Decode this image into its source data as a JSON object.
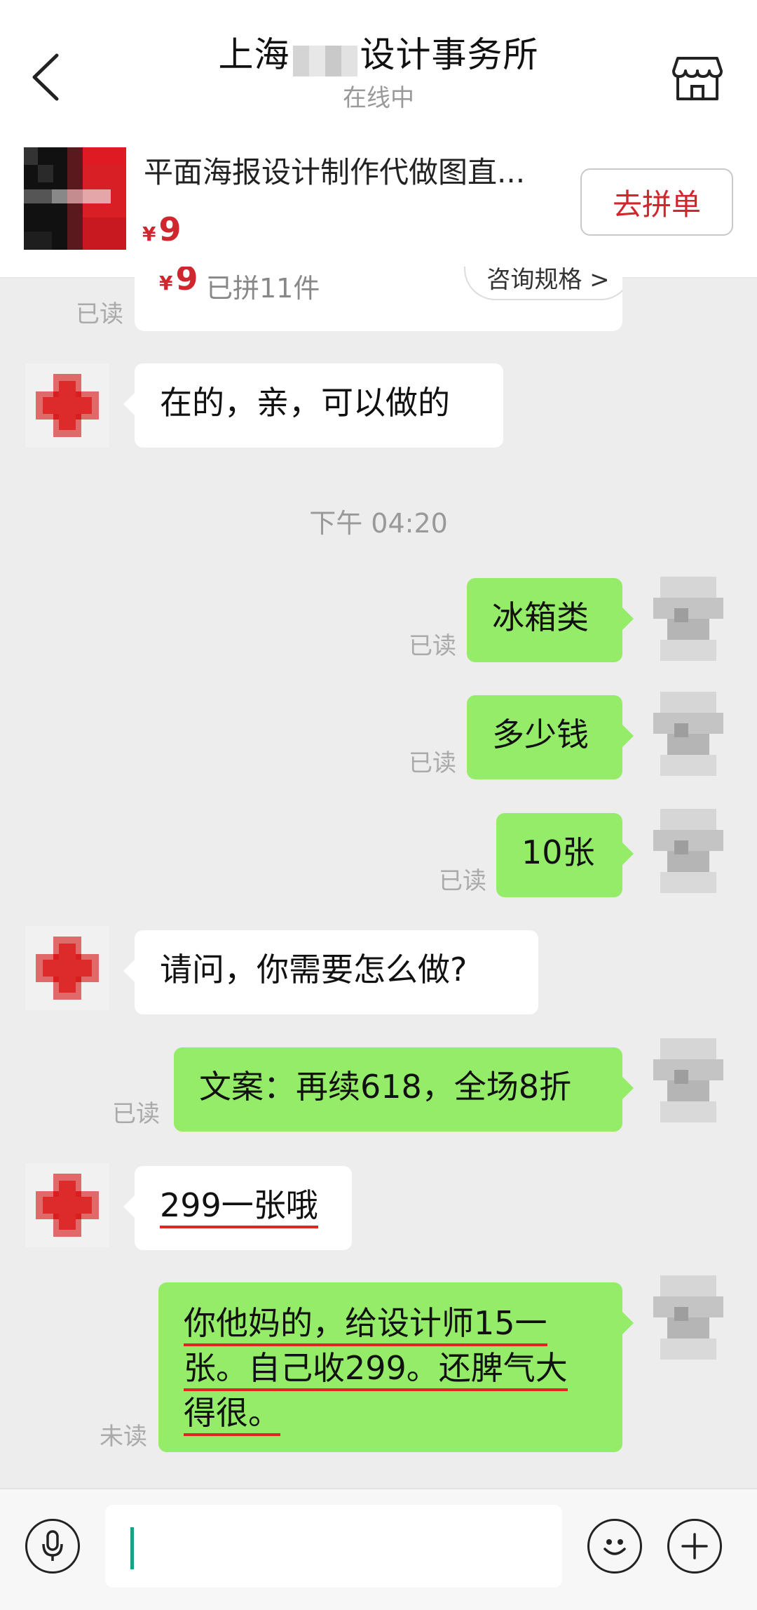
{
  "header": {
    "title_prefix": "上海",
    "title_suffix": "设计事务所",
    "status": "在线中"
  },
  "product": {
    "title": "平面海报设计制作代做图直...",
    "currency": "¥",
    "price": "9",
    "group_button": "去拼单"
  },
  "partial_card": {
    "currency": "¥",
    "price": "9",
    "sold": "已拼11件",
    "consult": "咨询规格 >",
    "read": "已读"
  },
  "messages": {
    "m1": "在的，亲，可以做的",
    "time": "下午 04:20",
    "m2": "冰箱类",
    "m3": "多少钱",
    "m4": "10张",
    "m5": "请问，你需要怎么做?",
    "m6": "文案：再续618，全场8折",
    "m7": "299一张哦",
    "m8_line1": "你他妈的，给设计师15一",
    "m8_line2": "张。自己收299。还脾气大",
    "m8_line3": "得很。"
  },
  "read_labels": {
    "read": "已读",
    "unread": "未读"
  },
  "colors": {
    "accent_red": "#d0262e",
    "bubble_green": "#95ec69",
    "caret": "#1aa085"
  }
}
